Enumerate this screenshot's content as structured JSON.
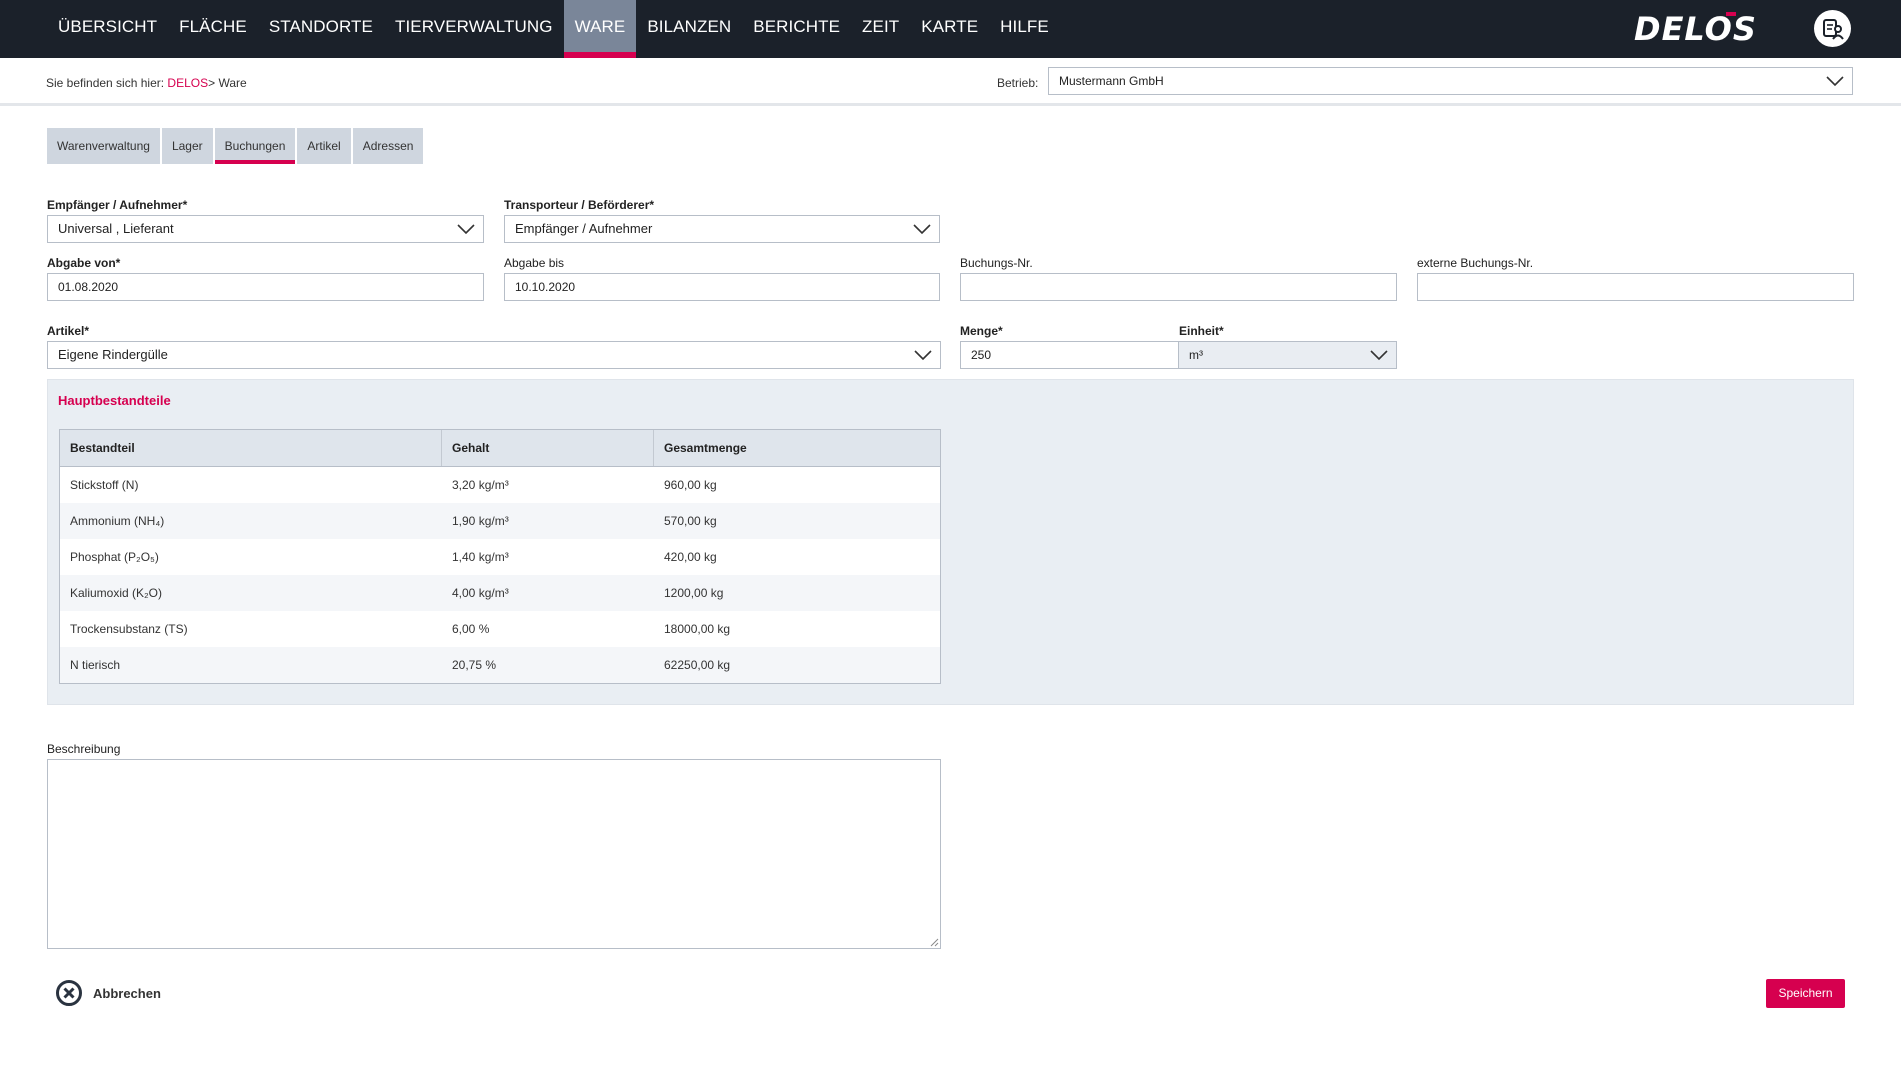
{
  "nav": {
    "items": [
      {
        "label": "ÜBERSICHT"
      },
      {
        "label": "FLÄCHE"
      },
      {
        "label": "STANDORTE"
      },
      {
        "label": "TIERVERWALTUNG"
      },
      {
        "label": "WARE",
        "active": true
      },
      {
        "label": "BILANZEN"
      },
      {
        "label": "BERICHTE"
      },
      {
        "label": "ZEIT"
      },
      {
        "label": "KARTE"
      },
      {
        "label": "HILFE"
      }
    ],
    "logo_text": "DELOS",
    "profile_icon": "user-profile-icon"
  },
  "breadcrumb": {
    "prefix": "Sie befinden sich hier:",
    "link": "DELOS",
    "separator": ">",
    "current": "Ware"
  },
  "betrieb": {
    "label": "Betrieb:",
    "value": "Mustermann GmbH"
  },
  "tabs": [
    {
      "label": "Warenverwaltung"
    },
    {
      "label": "Lager"
    },
    {
      "label": "Buchungen",
      "active": true
    },
    {
      "label": "Artikel"
    },
    {
      "label": "Adressen"
    }
  ],
  "form": {
    "empfaenger": {
      "label": "Empfänger / Aufnehmer*",
      "value": "Universal , Lieferant"
    },
    "transporteur": {
      "label": "Transporteur / Beförderer*",
      "value": "Empfänger / Aufnehmer"
    },
    "abgabe_von": {
      "label": "Abgabe von*",
      "value": "01.08.2020"
    },
    "abgabe_bis": {
      "label": "Abgabe bis",
      "value": "10.10.2020"
    },
    "buchungs_nr": {
      "label": "Buchungs-Nr.",
      "value": ""
    },
    "externe_buchungs_nr": {
      "label": "externe Buchungs-Nr.",
      "value": ""
    },
    "artikel": {
      "label": "Artikel*",
      "value": "Eigene Rindergülle"
    },
    "menge": {
      "label": "Menge*",
      "value": "250"
    },
    "einheit": {
      "label": "Einheit*",
      "value": "m³"
    }
  },
  "hauptbestandteile": {
    "title": "Hauptbestandteile",
    "columns": [
      "Bestandteil",
      "Gehalt",
      "Gesamtmenge"
    ],
    "rows": [
      [
        "Stickstoff (N)",
        "3,20 kg/m³",
        "960,00 kg"
      ],
      [
        "Ammonium (NH₄)",
        "1,90 kg/m³",
        "570,00 kg"
      ],
      [
        "Phosphat (P₂O₅)",
        "1,40 kg/m³",
        "420,00 kg"
      ],
      [
        "Kaliumoxid (K₂O)",
        "4,00 kg/m³",
        "1200,00 kg"
      ],
      [
        "Trockensubstanz (TS)",
        "6,00 %",
        "18000,00 kg"
      ],
      [
        "N tierisch",
        "20,75 %",
        "62250,00 kg"
      ]
    ]
  },
  "beschreibung": {
    "label": "Beschreibung",
    "value": ""
  },
  "actions": {
    "cancel_label": "Abbrechen",
    "save_label": "Speichern"
  },
  "colors": {
    "accent": "#d6004f",
    "nav_bg": "#1b212a",
    "nav_active_bg": "#7a8699",
    "panel_bg": "#e9eef3"
  }
}
